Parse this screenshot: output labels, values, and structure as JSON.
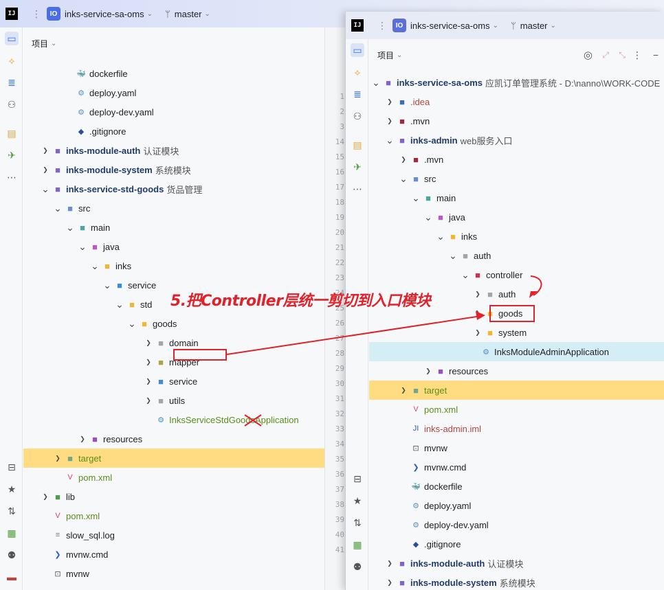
{
  "left": {
    "project": "inks-service-sa-oms",
    "branch": "master",
    "panel_label": "项目",
    "rows": [
      {
        "text": "dockerfile",
        "note": "",
        "indent": 60,
        "arrow": "",
        "icon": "docker",
        "bold": false,
        "color": ""
      },
      {
        "text": "deploy.yaml",
        "note": "",
        "indent": 60,
        "arrow": "",
        "icon": "yaml",
        "bold": false,
        "color": ""
      },
      {
        "text": "deploy-dev.yaml",
        "note": "",
        "indent": 60,
        "arrow": "",
        "icon": "yaml",
        "bold": false,
        "color": ""
      },
      {
        "text": ".gitignore",
        "note": "",
        "indent": 60,
        "arrow": "",
        "icon": "git",
        "bold": false,
        "color": ""
      },
      {
        "text": "inks-module-auth",
        "note": "认证模块",
        "indent": 26,
        "arrow": "right",
        "icon": "module",
        "bold": true,
        "color": ""
      },
      {
        "text": "inks-module-system",
        "note": "系统模块",
        "indent": 26,
        "arrow": "right",
        "icon": "module",
        "bold": true,
        "color": ""
      },
      {
        "text": "inks-service-std-goods",
        "note": "货品管理",
        "indent": 26,
        "arrow": "down",
        "icon": "module",
        "bold": true,
        "color": ""
      },
      {
        "text": "src",
        "note": "",
        "indent": 44,
        "arrow": "down",
        "icon": "src",
        "bold": false,
        "color": ""
      },
      {
        "text": "main",
        "note": "",
        "indent": 62,
        "arrow": "down",
        "icon": "main",
        "bold": false,
        "color": ""
      },
      {
        "text": "java",
        "note": "",
        "indent": 80,
        "arrow": "down",
        "icon": "java",
        "bold": false,
        "color": ""
      },
      {
        "text": "inks",
        "note": "",
        "indent": 98,
        "arrow": "down",
        "icon": "folder",
        "bold": false,
        "color": ""
      },
      {
        "text": "service",
        "note": "",
        "indent": 116,
        "arrow": "down",
        "icon": "pkgblue",
        "bold": false,
        "color": ""
      },
      {
        "text": "std",
        "note": "",
        "indent": 134,
        "arrow": "down",
        "icon": "folder",
        "bold": false,
        "color": ""
      },
      {
        "text": "goods",
        "note": "",
        "indent": 152,
        "arrow": "down",
        "icon": "folder",
        "bold": false,
        "color": ""
      },
      {
        "text": "domain",
        "note": "",
        "indent": 176,
        "arrow": "right",
        "icon": "pkggray",
        "bold": false,
        "color": ""
      },
      {
        "text": "mapper",
        "note": "",
        "indent": 176,
        "arrow": "right",
        "icon": "pkgolive",
        "bold": false,
        "color": ""
      },
      {
        "text": "service",
        "note": "",
        "indent": 176,
        "arrow": "right",
        "icon": "pkgblue",
        "bold": false,
        "color": ""
      },
      {
        "text": "utils",
        "note": "",
        "indent": 176,
        "arrow": "right",
        "icon": "pkggray",
        "bold": false,
        "color": ""
      },
      {
        "text": "InksServiceStdGoodsApplication",
        "note": "",
        "indent": 176,
        "arrow": "",
        "icon": "app",
        "bold": false,
        "color": "green"
      },
      {
        "text": "resources",
        "note": "",
        "indent": 80,
        "arrow": "right",
        "icon": "res",
        "bold": false,
        "color": ""
      },
      {
        "text": "target",
        "note": "",
        "indent": 44,
        "arrow": "right",
        "icon": "target",
        "bold": false,
        "color": "green",
        "hl": true
      },
      {
        "text": "pom.xml",
        "note": "",
        "indent": 44,
        "arrow": "",
        "icon": "maven",
        "bold": false,
        "color": "green"
      },
      {
        "text": "lib",
        "note": "",
        "indent": 26,
        "arrow": "right",
        "icon": "lib",
        "bold": false,
        "color": ""
      },
      {
        "text": "pom.xml",
        "note": "",
        "indent": 26,
        "arrow": "",
        "icon": "maven",
        "bold": false,
        "color": "green"
      },
      {
        "text": "slow_sql.log",
        "note": "",
        "indent": 26,
        "arrow": "",
        "icon": "log",
        "bold": false,
        "color": ""
      },
      {
        "text": "mvnw.cmd",
        "note": "",
        "indent": 26,
        "arrow": "",
        "icon": "cmd",
        "bold": false,
        "color": ""
      },
      {
        "text": "mvnw",
        "note": "",
        "indent": 26,
        "arrow": "",
        "icon": "term",
        "bold": false,
        "color": ""
      }
    ],
    "line_numbers": [
      "1",
      "2",
      "3",
      "14",
      "15",
      "16",
      "17",
      "18",
      "19",
      "20",
      "21",
      "22",
      "23",
      "24",
      "25",
      "26",
      "27",
      "28",
      "29",
      "30",
      "31",
      "32",
      "33",
      "34",
      "35",
      "36",
      "37",
      "38",
      "39",
      "40",
      "41"
    ]
  },
  "right": {
    "project": "inks-service-sa-oms",
    "branch": "master",
    "panel_label": "项目",
    "rows": [
      {
        "text": "inks-service-sa-oms",
        "note": "应凯订单管理系统  - D:\\nanno\\WORK-CODE",
        "indent": 4,
        "arrow": "down",
        "icon": "module",
        "bold": true,
        "color": ""
      },
      {
        "text": ".idea",
        "note": "",
        "indent": 24,
        "arrow": "right",
        "icon": "idea",
        "bold": false,
        "color": "red"
      },
      {
        "text": ".mvn",
        "note": "",
        "indent": 24,
        "arrow": "right",
        "icon": "mvn",
        "bold": false,
        "color": ""
      },
      {
        "text": "inks-admin",
        "note": "web服务入口",
        "indent": 24,
        "arrow": "down",
        "icon": "module",
        "bold": true,
        "color": ""
      },
      {
        "text": ".mvn",
        "note": "",
        "indent": 44,
        "arrow": "right",
        "icon": "mvn",
        "bold": false,
        "color": ""
      },
      {
        "text": "src",
        "note": "",
        "indent": 44,
        "arrow": "down",
        "icon": "src",
        "bold": false,
        "color": ""
      },
      {
        "text": "main",
        "note": "",
        "indent": 62,
        "arrow": "down",
        "icon": "main",
        "bold": false,
        "color": ""
      },
      {
        "text": "java",
        "note": "",
        "indent": 80,
        "arrow": "down",
        "icon": "java",
        "bold": false,
        "color": ""
      },
      {
        "text": "inks",
        "note": "",
        "indent": 98,
        "arrow": "down",
        "icon": "folder",
        "bold": false,
        "color": ""
      },
      {
        "text": "auth",
        "note": "",
        "indent": 116,
        "arrow": "down",
        "icon": "pkggray",
        "bold": false,
        "color": ""
      },
      {
        "text": "controller",
        "note": "",
        "indent": 134,
        "arrow": "down",
        "icon": "ctrl",
        "bold": false,
        "color": ""
      },
      {
        "text": "auth",
        "note": "",
        "indent": 152,
        "arrow": "right",
        "icon": "pkggray",
        "bold": false,
        "color": ""
      },
      {
        "text": "goods",
        "note": "",
        "indent": 152,
        "arrow": "right",
        "icon": "folder",
        "bold": false,
        "color": ""
      },
      {
        "text": "system",
        "note": "",
        "indent": 152,
        "arrow": "right",
        "icon": "folder",
        "bold": false,
        "color": ""
      },
      {
        "text": "InksModuleAdminApplication",
        "note": "",
        "indent": 146,
        "arrow": "",
        "icon": "app",
        "bold": false,
        "color": "",
        "sel": true
      },
      {
        "text": "resources",
        "note": "",
        "indent": 80,
        "arrow": "right",
        "icon": "res",
        "bold": false,
        "color": ""
      },
      {
        "text": "target",
        "note": "",
        "indent": 44,
        "arrow": "right",
        "icon": "target",
        "bold": false,
        "color": "green",
        "hl": true
      },
      {
        "text": "pom.xml",
        "note": "",
        "indent": 44,
        "arrow": "",
        "icon": "maven",
        "bold": false,
        "color": "green"
      },
      {
        "text": "inks-admin.iml",
        "note": "",
        "indent": 44,
        "arrow": "",
        "icon": "iml",
        "bold": false,
        "color": "red"
      },
      {
        "text": "mvnw",
        "note": "",
        "indent": 44,
        "arrow": "",
        "icon": "term",
        "bold": false,
        "color": ""
      },
      {
        "text": "mvnw.cmd",
        "note": "",
        "indent": 44,
        "arrow": "",
        "icon": "cmd",
        "bold": false,
        "color": ""
      },
      {
        "text": "dockerfile",
        "note": "",
        "indent": 44,
        "arrow": "",
        "icon": "docker",
        "bold": false,
        "color": ""
      },
      {
        "text": "deploy.yaml",
        "note": "",
        "indent": 44,
        "arrow": "",
        "icon": "yaml",
        "bold": false,
        "color": ""
      },
      {
        "text": "deploy-dev.yaml",
        "note": "",
        "indent": 44,
        "arrow": "",
        "icon": "yaml",
        "bold": false,
        "color": ""
      },
      {
        "text": ".gitignore",
        "note": "",
        "indent": 44,
        "arrow": "",
        "icon": "git",
        "bold": false,
        "color": ""
      },
      {
        "text": "inks-module-auth",
        "note": "认证模块",
        "indent": 24,
        "arrow": "right",
        "icon": "module",
        "bold": true,
        "color": ""
      },
      {
        "text": "inks-module-system",
        "note": "系统模块",
        "indent": 24,
        "arrow": "right",
        "icon": "module",
        "bold": true,
        "color": ""
      }
    ]
  },
  "annotation": {
    "text": "5.把Controller层统一剪切到入口模块",
    "color": "#e0222a"
  },
  "colors": {
    "accent": "#3574f0",
    "highlight": "#ffdc82",
    "selection": "#d5edf5",
    "annotation": "#e0222a"
  }
}
